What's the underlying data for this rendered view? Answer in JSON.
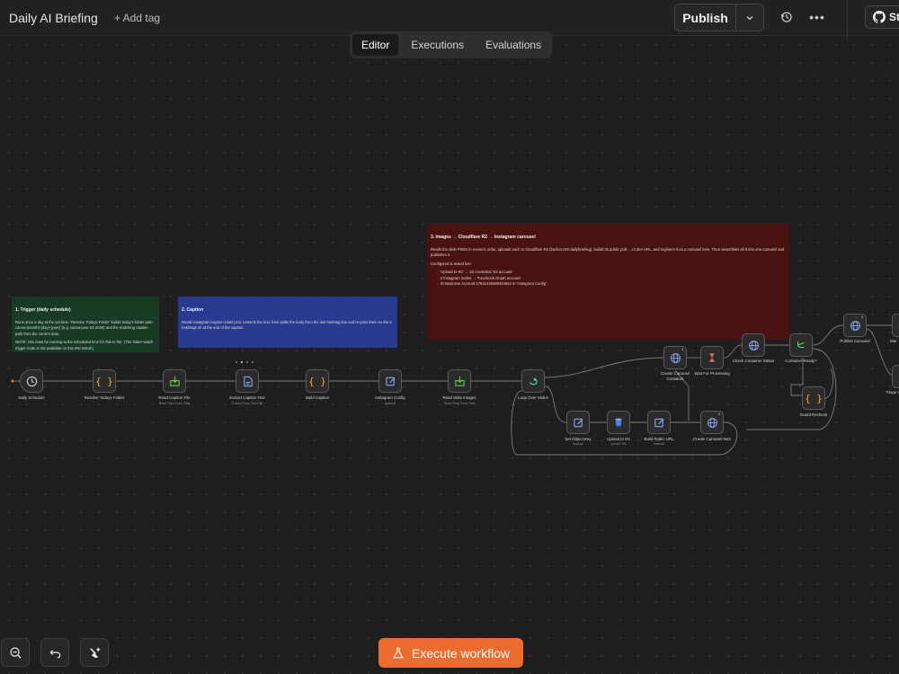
{
  "header": {
    "title": "Daily AI Briefing",
    "add_tag": "+ Add tag",
    "publish": "Publish",
    "github_label": "St"
  },
  "tabs": [
    "Editor",
    "Executions",
    "Evaluations"
  ],
  "stickies": {
    "trigger": {
      "title": "1. Trigger (daily schedule)",
      "body": "Runs once a day at the set time. 'Resolve Todays Folder' builds today's folder path canva-{month}-{day}-{year} (e.g. canva-june-24-2026) and the matching caption path from the current date.",
      "note": "NOTE: n8n must be running at the scheduled time for this to fire. (The folder-watch trigger node is not available on this n8n install.)",
      "color": "#173a22"
    },
    "caption": {
      "title": "2. Caption",
      "body": "Reads instagram-caption-{date}.md, extracts the text, then splits the body from the last hashtag line and re-joins them so the 5 hashtags sit at the end of the caption.",
      "color": "#283a90"
    },
    "images": {
      "title": "3. Images → Cloudflare R2 → Instagram carousel",
      "body": "Reads the slide PNGs in numeric order, uploads each to Cloudflare R2 (bucket n8n-dailybriefing), builds its public pub-....r2.dev URL, and registers it as a carousel item. Then assembles all 8 into one carousel and publishes it.",
      "configured": "Configured & tested live:",
      "items": [
        "'Upload to R2' → S3 credential 'S3 account'",
        "3 Instagram nodes → 'Facebook Graph account'",
        "IG Business Account 17841425689324842 in 'Instagram Config'"
      ],
      "color": "#4a1111"
    }
  },
  "nodes": [
    {
      "label": "Daily Schedule",
      "sub": "",
      "icon": "clock-icon",
      "color": "#cfcfcf"
    },
    {
      "label": "Resolve Todays Folder",
      "sub": "",
      "icon": "code-braces-icon",
      "color": "#e8a54b"
    },
    {
      "label": "Read Caption File",
      "sub": "Read Files From Disk",
      "icon": "read-file-icon",
      "color": "#6cc24a"
    },
    {
      "label": "Extract Caption Text",
      "sub": "Extract From Text File",
      "icon": "extract-file-icon",
      "color": "#7fa8e8"
    },
    {
      "label": "Build Caption",
      "sub": "",
      "icon": "code-braces-icon",
      "color": "#e8a54b"
    },
    {
      "label": "Instagram Config",
      "sub": "manual",
      "icon": "edit-icon",
      "color": "#8aa3f0"
    },
    {
      "label": "Read Slide Images",
      "sub": "Read Files From Disk",
      "icon": "read-file-icon",
      "color": "#6cc24a"
    },
    {
      "label": "Loop Over Slides",
      "sub": "",
      "icon": "loop-icon",
      "color": "#5fd0a0"
    },
    {
      "label": "Set Object Key",
      "sub": "manual",
      "icon": "edit-icon",
      "color": "#8aa3f0"
    },
    {
      "label": "Upload to R2",
      "sub": "upload: file",
      "icon": "s3-bucket-icon",
      "color": "#4a7de0"
    },
    {
      "label": "Build Public URL",
      "sub": "manual",
      "icon": "edit-icon",
      "color": "#8aa3f0"
    },
    {
      "label": "Create Carousel Item",
      "sub": "",
      "icon": "globe-icon",
      "color": "#8aa3f0"
    },
    {
      "label": "Create Carousel Container",
      "sub": "",
      "icon": "globe-icon",
      "color": "#8aa3f0"
    },
    {
      "label": "Wait For Processing",
      "sub": "",
      "icon": "hourglass-icon",
      "color": "#e26a7a"
    },
    {
      "label": "Check Container Status",
      "sub": "",
      "icon": "globe-icon",
      "color": "#8aa3f0"
    },
    {
      "label": "Container Ready?",
      "sub": "",
      "icon": "if-branch-icon",
      "color": "#5fd07a"
    },
    {
      "label": "Guard Recheck",
      "sub": "",
      "icon": "code-braces-icon",
      "color": "#e8a54b"
    },
    {
      "label": "Publish Carousel",
      "sub": "",
      "icon": "globe-icon",
      "color": "#8aa3f0"
    },
    {
      "label": "Mar",
      "sub": "",
      "icon": "node-icon",
      "color": "#8aa3f0"
    },
    {
      "label": "Triage I",
      "sub": "",
      "icon": "node-icon",
      "color": "#8aa3f0"
    }
  ],
  "badges": {
    "carousel_container": "3",
    "carousel_item": "0",
    "publish": "4"
  },
  "footer": {
    "execute": "Execute workflow"
  },
  "colors": {
    "accent": "#ec6b2f",
    "canvas": "#1e1e1e"
  }
}
